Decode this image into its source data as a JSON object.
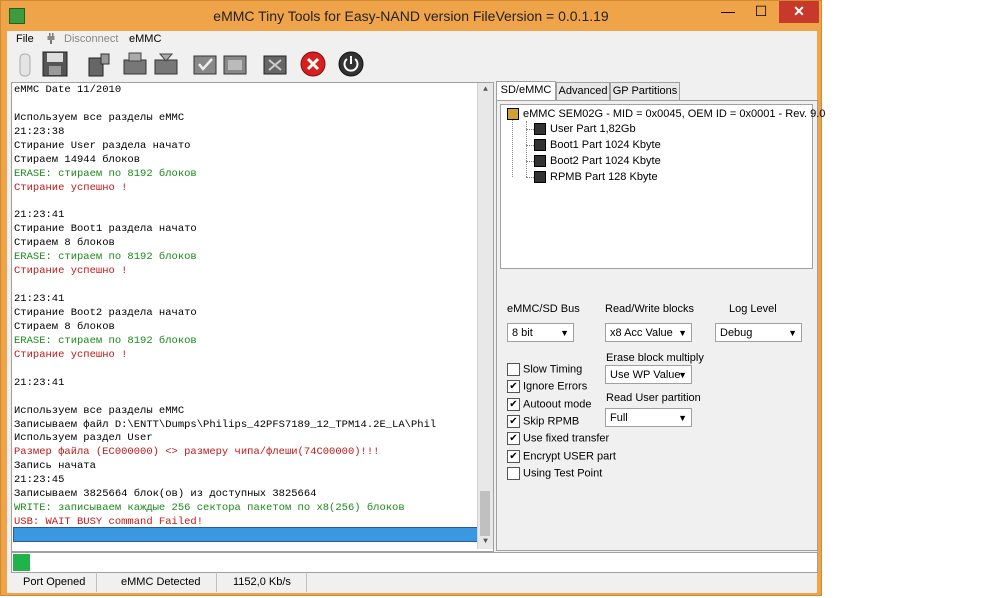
{
  "window": {
    "title": "eMMC Tiny Tools for Easy-NAND version FileVersion = 0.0.1.19",
    "minimize": "—",
    "maximize": "☐",
    "close": "✕"
  },
  "menu": {
    "file": "File",
    "disconnect": "Disconnect",
    "emmc": "eMMC"
  },
  "toolbar_icons": [
    "connect-icon",
    "save-icon",
    "read-icon",
    "write-icon",
    "write-all-icon",
    "verify-icon",
    "format-icon",
    "erase-icon",
    "stop-icon",
    "power-icon"
  ],
  "log": {
    "lines": [
      {
        "text": "eMMC Date 11/2010",
        "color": "black"
      },
      {
        "text": "",
        "color": "black"
      },
      {
        "text": "Используем все разделы eMMC",
        "color": "black"
      },
      {
        "text": "21:23:38",
        "color": "black"
      },
      {
        "text": "Стирание User раздела начато",
        "color": "black"
      },
      {
        "text": "Стираем 14944 блоков",
        "color": "black"
      },
      {
        "text": "ERASE: стираем по 8192 блоков",
        "color": "green"
      },
      {
        "text": "Стирание успешно !",
        "color": "red"
      },
      {
        "text": "",
        "color": "black"
      },
      {
        "text": "21:23:41",
        "color": "black"
      },
      {
        "text": "Стирание Boot1 раздела начато",
        "color": "black"
      },
      {
        "text": "Стираем 8 блоков",
        "color": "black"
      },
      {
        "text": "ERASE: стираем по 8192 блоков",
        "color": "green"
      },
      {
        "text": "Стирание успешно !",
        "color": "red"
      },
      {
        "text": "",
        "color": "black"
      },
      {
        "text": "21:23:41",
        "color": "black"
      },
      {
        "text": "Стирание Boot2 раздела начато",
        "color": "black"
      },
      {
        "text": "Стираем 8 блоков",
        "color": "black"
      },
      {
        "text": "ERASE: стираем по 8192 блоков",
        "color": "green"
      },
      {
        "text": "Стирание успешно !",
        "color": "red"
      },
      {
        "text": "",
        "color": "black"
      },
      {
        "text": "21:23:41",
        "color": "black"
      },
      {
        "text": "",
        "color": "black"
      },
      {
        "text": "Используем все разделы eMMC",
        "color": "black"
      },
      {
        "text": "Записываем файл D:\\ENTT\\Dumps\\Philips_42PFS7189_12_TPM14.2E_LA\\Phil",
        "color": "black"
      },
      {
        "text": "Используем раздел User",
        "color": "black"
      },
      {
        "text": "Размер файла (EC000000) <> размеру чипа/флеши(74C00000)!!!",
        "color": "red"
      },
      {
        "text": "Запись начата",
        "color": "black"
      },
      {
        "text": "21:23:45",
        "color": "black"
      },
      {
        "text": "Записываем 3825664 блок(ов) из доступных 3825664",
        "color": "black"
      },
      {
        "text": "WRITE: записываем каждые 256 сектора пакетом по x8(256) блоков",
        "color": "green"
      },
      {
        "text": "USB: WAIT BUSY command Failed!",
        "color": "red"
      }
    ],
    "progress": 1.0
  },
  "tabs": [
    {
      "label": "SD/eMMC",
      "active": true
    },
    {
      "label": "Advanced",
      "active": false
    },
    {
      "label": "GP Partitions",
      "active": false
    }
  ],
  "tree": {
    "root": "eMMC SEM02G - MID = 0x0045, OEM ID = 0x0001 - Rev. 9.0",
    "children": [
      "User Part 1,82Gb",
      "Boot1 Part 1024 Kbyte",
      "Boot2 Part 1024 Kbyte",
      "RPMB Part 128 Kbyte"
    ]
  },
  "settings": {
    "bus_label": "eMMC/SD Bus",
    "bus_value": "8 bit",
    "rw_label": "Read/Write  blocks",
    "rw_value": "x8 Acc Value",
    "log_label": "Log Level",
    "log_value": "Debug",
    "erase_label": "Erase block multiply",
    "erase_value": "Use WP Value",
    "readuser_label": "Read User partition",
    "readuser_value": "Full"
  },
  "checkboxes": [
    {
      "label": "Slow Timing",
      "checked": false
    },
    {
      "label": "Ignore Errors",
      "checked": true
    },
    {
      "label": "Autoout mode",
      "checked": true
    },
    {
      "label": "Skip RPMB",
      "checked": true
    },
    {
      "label": "Use fixed transfer",
      "checked": true
    },
    {
      "label": "Encrypt USER part",
      "checked": true
    },
    {
      "label": "Using Test Point",
      "checked": false
    }
  ],
  "status": {
    "port": "Port Opened",
    "emmc": "eMMC Detected",
    "speed": "1152,0 Kb/s"
  },
  "colors": {
    "title_bar": "#f0a44a",
    "log_green": "#1a8a1a",
    "log_red": "#c01818",
    "progress_blue": "#3a98e0",
    "progress_green": "#1fb34a"
  }
}
